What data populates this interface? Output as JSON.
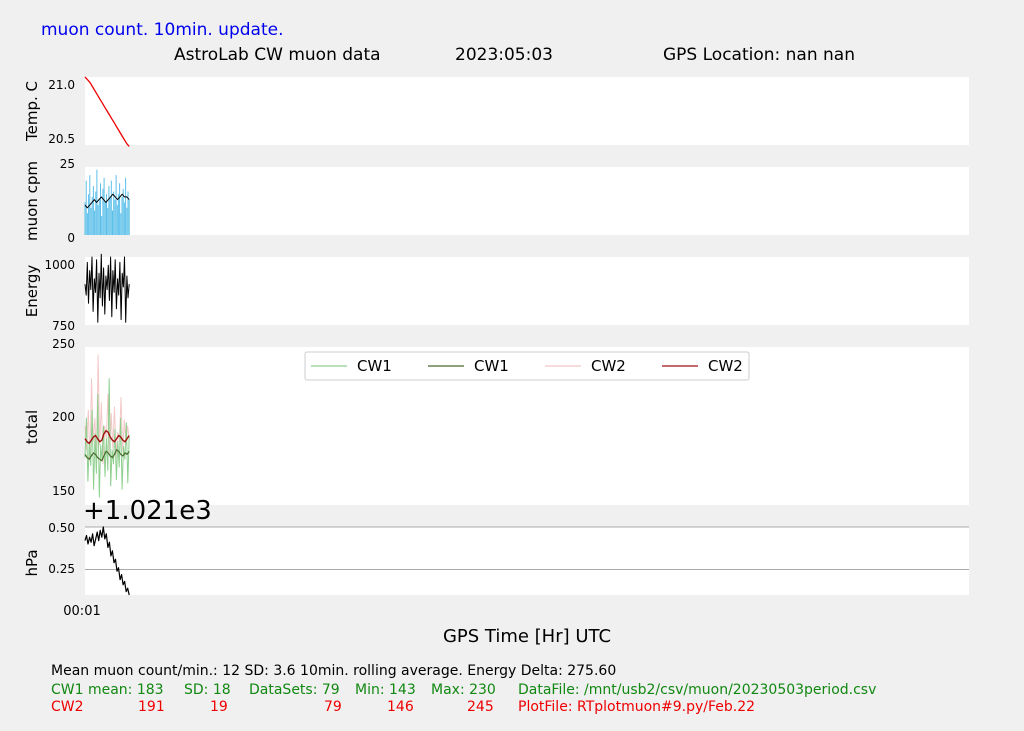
{
  "header": {
    "update_note": "muon count.  10min. update.",
    "title": "AstroLab CW muon data",
    "date": "2023:05:03",
    "gps_location": "GPS Location: nan   nan"
  },
  "colors": {
    "temp": "#ee0000",
    "muon_bars": "#5bbfea",
    "muon_avg": "#000000",
    "energy": "#000000",
    "cw1_raw": "#8fcf8f",
    "cw1_avg": "#4a6a2a",
    "cw2_raw": "#f4c8c8",
    "cw2_avg": "#a01010",
    "pressure": "#000000",
    "pressure_lines": "#aaaaaa"
  },
  "chart_data": [
    {
      "type": "line",
      "ylabel": "Temp. C",
      "yticks": [
        "21.0",
        "20.5"
      ],
      "ylim": [
        20.5,
        21.0
      ],
      "xlim": [
        0,
        1
      ],
      "x_range": [
        0,
        0.05
      ],
      "series": [
        {
          "values": [
            21.0,
            20.98,
            20.96,
            20.93,
            20.9,
            20.87,
            20.84,
            20.81,
            20.78,
            20.75,
            20.72,
            20.69,
            20.66,
            20.63,
            20.6,
            20.57,
            20.54,
            20.51,
            20.49
          ]
        }
      ]
    },
    {
      "type": "bar",
      "ylabel": "muon cpm",
      "yticks": [
        "25",
        "0"
      ],
      "ylim": [
        0,
        25
      ],
      "xlim": [
        0,
        1
      ],
      "x_range": [
        0,
        0.05
      ],
      "values": [
        12,
        20,
        8,
        15,
        22,
        10,
        14,
        18,
        9,
        16,
        24,
        11,
        13,
        19,
        7,
        17,
        21,
        12,
        15,
        10,
        18,
        14,
        20,
        9,
        16,
        13,
        22,
        11,
        15,
        19,
        8,
        14,
        17,
        12,
        21,
        10,
        16,
        13
      ],
      "series": [
        {
          "values": [
            11,
            10,
            11,
            12,
            13,
            12,
            13,
            14,
            13,
            12,
            13,
            14,
            15,
            14,
            13,
            14,
            15,
            14,
            14,
            13
          ]
        }
      ]
    },
    {
      "type": "line",
      "ylabel": "Energy",
      "yticks": [
        "1000",
        "750"
      ],
      "ylim": [
        750,
        1000
      ],
      "xlim": [
        0,
        1
      ],
      "x_range": [
        0,
        0.05
      ],
      "series": [
        {
          "values": [
            900,
            860,
            980,
            830,
            950,
            880,
            1000,
            800,
            920,
            870,
            990,
            760,
            940,
            850,
            1010,
            820,
            960,
            790,
            930,
            880,
            970,
            840,
            1000,
            780,
            950,
            870,
            990,
            810,
            920,
            860,
            980,
            770,
            940,
            890,
            1000,
            760,
            930,
            850,
            900
          ]
        }
      ]
    },
    {
      "type": "line",
      "ylabel": "total",
      "yticks": [
        "250",
        "200",
        "150"
      ],
      "ylim": [
        150,
        250
      ],
      "xlim": [
        0,
        1
      ],
      "x_range": [
        0,
        0.05
      ],
      "legend": [
        "CW1",
        "CW1",
        "CW2",
        "CW2"
      ],
      "legend_location": "top-center",
      "series": [
        {
          "name": "CW1",
          "values": [
            180,
            205,
            165,
            190,
            175,
            210,
            160,
            195,
            170,
            220,
            155,
            188,
            178,
            200,
            168,
            192,
            172,
            230,
            162,
            185,
            176,
            198,
            166,
            190,
            174,
            205,
            160,
            187,
            179,
            202,
            164,
            193
          ]
        },
        {
          "name": "CW1",
          "values": [
            182,
            180,
            179,
            181,
            183,
            182,
            180,
            179,
            178,
            181,
            184,
            183,
            181,
            180,
            182,
            185,
            184,
            182,
            181,
            183,
            182,
            184
          ]
        },
        {
          "name": "CW2",
          "values": [
            200,
            185,
            210,
            178,
            230,
            190,
            205,
            180,
            245,
            188,
            215,
            176,
            200,
            192,
            220,
            183,
            208,
            186,
            212,
            180,
            196,
            190,
            218,
            184,
            204,
            188,
            200,
            192
          ]
        },
        {
          "name": "CW2",
          "values": [
            192,
            190,
            189,
            191,
            193,
            194,
            192,
            190,
            191,
            195,
            197,
            196,
            193,
            191,
            190,
            192,
            194,
            193,
            191,
            190,
            192,
            194
          ]
        }
      ]
    },
    {
      "type": "line",
      "ylabel": "hPa",
      "yticks": [
        "0.50",
        "0.25"
      ],
      "ylim": [
        0.1,
        0.5
      ],
      "xlim": [
        0,
        1
      ],
      "x_range": [
        0,
        0.05
      ],
      "offset_label": "+1.021e3",
      "hlines": [
        0.5,
        0.25
      ],
      "series": [
        {
          "values": [
            0.42,
            0.45,
            0.4,
            0.44,
            0.41,
            0.46,
            0.39,
            0.43,
            0.47,
            0.42,
            0.48,
            0.44,
            0.5,
            0.43,
            0.46,
            0.38,
            0.41,
            0.33,
            0.36,
            0.29,
            0.31,
            0.24,
            0.26,
            0.19,
            0.22,
            0.16,
            0.18,
            0.12,
            0.14,
            0.1
          ]
        }
      ]
    }
  ],
  "x_axis": {
    "tick_label": "00:01",
    "title": "GPS Time  [Hr] UTC"
  },
  "stats": {
    "line1": "Mean muon count/min.: 12  SD: 3.6   10min. rolling average.    Energy Delta:  275.60",
    "cw1": {
      "label": "CW1 mean: 183",
      "sd": "SD: 18",
      "datasets": "DataSets: 79",
      "min": "Min: 143",
      "max": "Max: 230",
      "file": "DataFile: /mnt/usb2/csv/muon/20230503period.csv"
    },
    "cw2": {
      "label": "CW2",
      "mean": "191",
      "sd": "19",
      "datasets": "79",
      "min": "146",
      "max": "245",
      "file": "PlotFile: RTplotmuon#9.py/Feb.22"
    }
  }
}
